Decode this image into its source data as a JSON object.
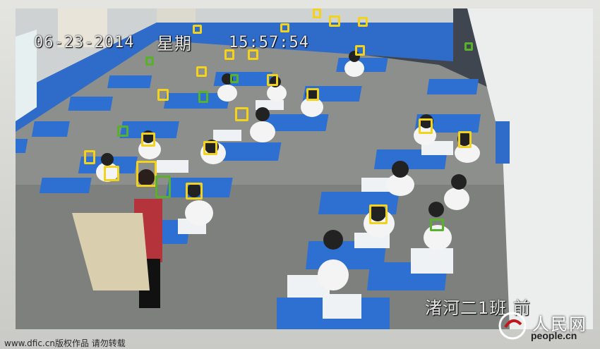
{
  "camera": {
    "date": "06-23-2014",
    "weekday_label": "星期",
    "time": "15:57:54",
    "class_label": "渚河二1班 前"
  },
  "detection": {
    "face_box_colors": {
      "default": "#f2d21a",
      "highlighted": "#58b02c"
    }
  },
  "footer": {
    "credit": "www.dfic.cn版权作品 请勿转载"
  },
  "brand": {
    "name": "人民网",
    "url": "people.cn"
  }
}
